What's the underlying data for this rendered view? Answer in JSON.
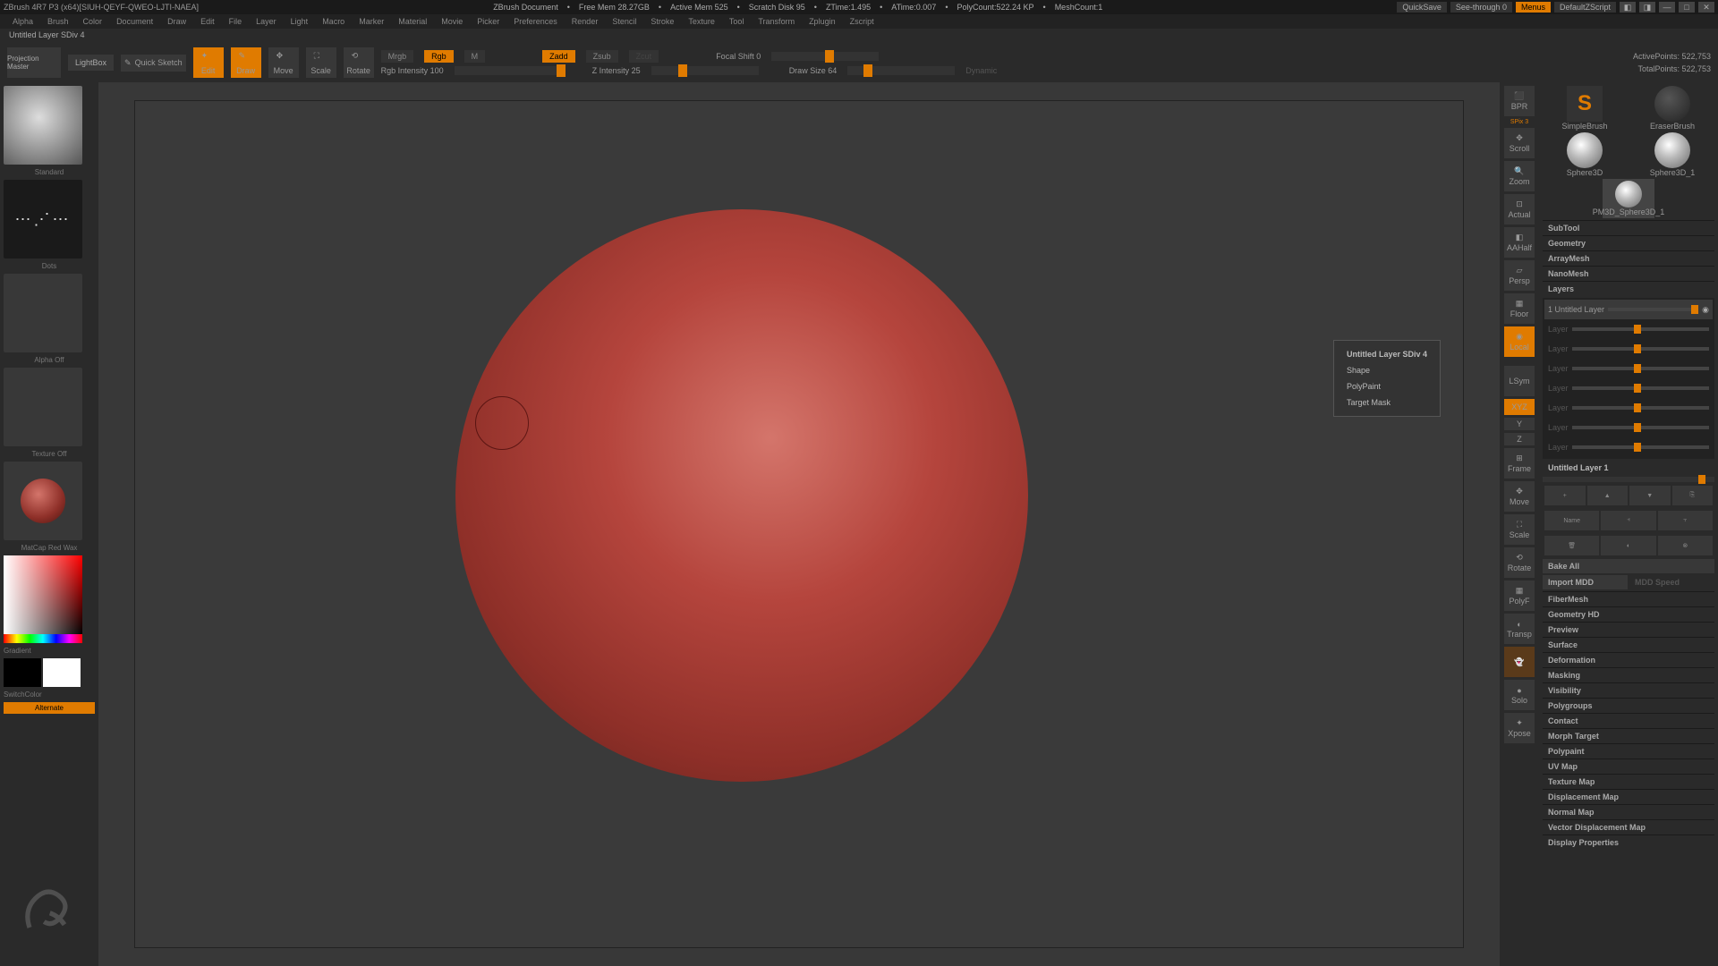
{
  "title": "ZBrush 4R7 P3 (x64)[SIUH-QEYF-QWEO-LJTI-NAEA]",
  "docname": "ZBrush Document",
  "stats": {
    "freemem": "Free Mem 28.27GB",
    "activemem": "Active Mem 525",
    "scratch": "Scratch Disk 95",
    "ztime": "ZTime:1.495",
    "atime": "ATime:0.007",
    "polycount": "PolyCount:522.24 KP",
    "meshcount": "MeshCount:1"
  },
  "topbuttons": {
    "quicksave": "QuickSave",
    "seethrough": "See-through  0",
    "menus": "Menus",
    "def": "DefaultZScript"
  },
  "menu": [
    "Alpha",
    "Brush",
    "Color",
    "Document",
    "Draw",
    "Edit",
    "File",
    "Layer",
    "Light",
    "Macro",
    "Marker",
    "Material",
    "Movie",
    "Picker",
    "Preferences",
    "Render",
    "Stencil",
    "Stroke",
    "Texture",
    "Tool",
    "Transform",
    "Zplugin",
    "Zscript"
  ],
  "infobar": "Untitled Layer SDiv 4",
  "toolbar": {
    "projection": "Projection Master",
    "lightbox": "LightBox",
    "quicksketch": "Quick Sketch",
    "edit": "Edit",
    "draw": "Draw",
    "move": "Move",
    "scale": "Scale",
    "rotate": "Rotate",
    "mrgb": "Mrgb",
    "rgb": "Rgb",
    "m": "M",
    "rgbint": "Rgb Intensity 100",
    "zadd": "Zadd",
    "zsub": "Zsub",
    "zcut": "Zcut",
    "zint": "Z Intensity 25",
    "focal": "Focal Shift 0",
    "drawsize": "Draw Size 64",
    "dynamic": "Dynamic",
    "active": "ActivePoints: 522,753",
    "total": "TotalPoints: 522,753"
  },
  "left": {
    "brush": "Standard",
    "stroke": "Dots",
    "alpha": "Alpha Off",
    "texture": "Texture Off",
    "material": "MatCap Red Wax",
    "gradient": "Gradient",
    "switchcolor": "SwitchColor",
    "alternate": "Alternate"
  },
  "vpbuttons": [
    "BPR",
    "Scroll",
    "Zoom",
    "Actual",
    "AAHalf",
    "Persp",
    "Floor",
    "Local",
    "LSym",
    "XYZ",
    "Y",
    "Z",
    "Frame",
    "Move",
    "Scale",
    "Rotate",
    "PolyF",
    "Transp",
    "Ghost",
    "Solo",
    "Xpose"
  ],
  "spix": "SPix 3",
  "popup": {
    "title": "Untitled Layer SDiv 4",
    "shape": "Shape",
    "polypaint": "PolyPaint",
    "target": "Target Mask"
  },
  "tools": {
    "simplebrush": "SimpleBrush",
    "eraserbrush": "EraserBrush",
    "sphere3d": "Sphere3D",
    "sphere3d1": "Sphere3D_1",
    "pm3d": "PM3D_Sphere3D_1"
  },
  "sections": [
    "SubTool",
    "Geometry",
    "ArrayMesh",
    "NanoMesh",
    "Layers"
  ],
  "sections2": [
    "FiberMesh",
    "Geometry HD",
    "Preview",
    "Surface",
    "Deformation",
    "Masking",
    "Visibility",
    "Polygroups",
    "Contact",
    "Morph Target",
    "Polypaint",
    "UV Map",
    "Texture Map",
    "Displacement Map",
    "Normal Map",
    "Vector Displacement Map",
    "Display Properties"
  ],
  "layers": {
    "first": "1 Untitled Layer",
    "others": [
      "Layer",
      "Layer",
      "Layer",
      "Layer",
      "Layer",
      "Layer",
      "Layer"
    ],
    "selected": "Untitled Layer 1",
    "bake": "Bake All",
    "import": "Import MDD",
    "mddspeed": "MDD Speed",
    "name": "Name"
  }
}
